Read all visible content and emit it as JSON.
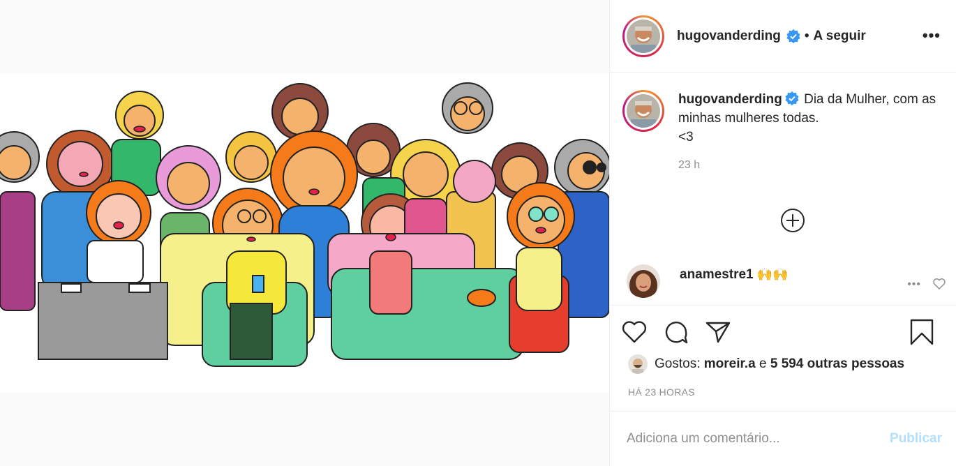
{
  "post": {
    "author": "hugovanderding",
    "separator": "•",
    "follow_label": "A seguir",
    "more_label": "•••"
  },
  "caption": {
    "author": "hugovanderding",
    "text": "Dia da Mulher, com as minhas mulheres todas.",
    "line2": "<3",
    "time": "23 h"
  },
  "comments": [
    {
      "author": "anamestre1",
      "text": "🙌🙌",
      "more_label": "•••"
    }
  ],
  "actions": {
    "likes_prefix": "Gostos:",
    "liked_by": "moreir.a",
    "likes_join": "e",
    "likes_others": "5 594 outras pessoas",
    "posted_ago": "HÁ 23 HORAS"
  },
  "add_comment": {
    "placeholder": "Adiciona um comentário...",
    "publish_label": "Publicar"
  },
  "colors": {
    "verified": "#3897f0",
    "publish_disabled": "#b2dffc",
    "muted": "#8e8e8e"
  }
}
